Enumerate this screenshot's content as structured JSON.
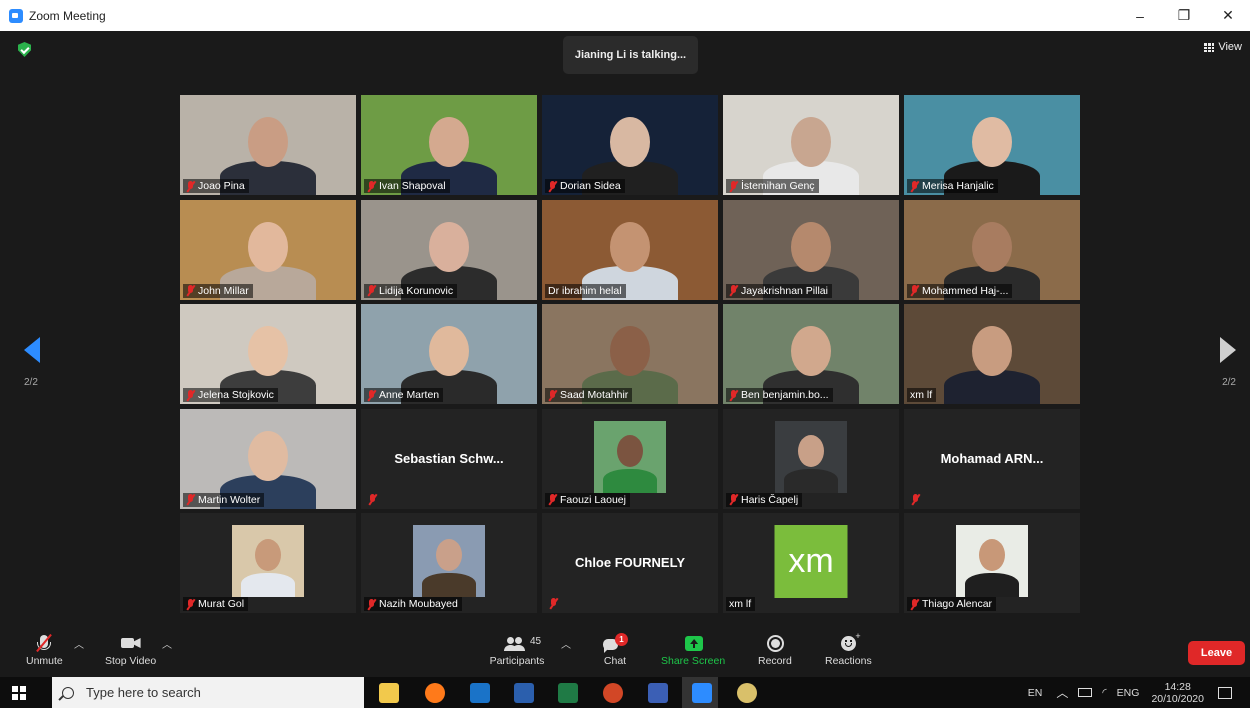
{
  "window": {
    "title": "Zoom Meeting",
    "controls": [
      "–",
      "❐",
      "✕"
    ]
  },
  "meeting": {
    "talking_indicator": "Jianing Li is talking...",
    "view_label": "View",
    "page_left": "2/2",
    "page_right": "2/2"
  },
  "participants": [
    {
      "name": "Joao Pina",
      "type": "video",
      "bg": "#b9b2a8",
      "head": "#c99d84",
      "body": "#2b2f3a"
    },
    {
      "name": "Ivan Shapoval",
      "type": "video",
      "bg": "#6e9c45",
      "head": "#d4a98f",
      "body": "#1f2a44"
    },
    {
      "name": "Dorian Sidea",
      "type": "video",
      "bg": "#152238",
      "head": "#d8b8a2",
      "body": "#202020"
    },
    {
      "name": "İstemihan Genç",
      "type": "video",
      "bg": "#d7d4cd",
      "head": "#c8a690",
      "body": "#e8e8e8"
    },
    {
      "name": "Merisa Hanjalic",
      "type": "video",
      "bg": "#4a8fa3",
      "head": "#e0bba3",
      "body": "#1a1a1a"
    },
    {
      "name": "John Millar",
      "type": "video",
      "bg": "#b88d52",
      "head": "#e2b89c",
      "body": "#b8a89a"
    },
    {
      "name": "Lidija Korunovic",
      "type": "video",
      "bg": "#9a948c",
      "head": "#d9b09c",
      "body": "#2c2c2c"
    },
    {
      "name": "Dr ibrahim helal",
      "type": "video",
      "bg": "#8c5a34",
      "head": "#c49372",
      "body": "#cfd6de"
    },
    {
      "name": "Jayakrishnan Pillai",
      "type": "video",
      "bg": "#6f6257",
      "head": "#b5896d",
      "body": "#3a3a3a"
    },
    {
      "name": "Mohammed Haj-...",
      "type": "video",
      "bg": "#8b6b4a",
      "head": "#a87c60",
      "body": "#2b2b2b"
    },
    {
      "name": "Jelena Stojkovic",
      "type": "video",
      "bg": "#cfc9c0",
      "head": "#e6c2a6",
      "body": "#3d3d3d"
    },
    {
      "name": "Anne Marten",
      "type": "video",
      "bg": "#8fa2ac",
      "head": "#e0b99c",
      "body": "#2a2a2a"
    },
    {
      "name": "Saad Motahhir",
      "type": "video",
      "bg": "#8a7560",
      "head": "#8b6048",
      "body": "#5b6b4a"
    },
    {
      "name": "Ben benjamin.bo...",
      "type": "video",
      "bg": "#71836a",
      "head": "#d1a88d",
      "body": "#2f2f2f"
    },
    {
      "name": "xm lf",
      "type": "video",
      "bg": "#5d4a38",
      "head": "#c89c80",
      "body": "#1e2230"
    },
    {
      "name": "Martin Wolter",
      "type": "video",
      "bg": "#bcbab8",
      "head": "#e0bba1",
      "body": "#2c3f5c"
    },
    {
      "name": "Sebastian  Schw...",
      "type": "name"
    },
    {
      "name": "Faouzi Laouej",
      "type": "photo",
      "bg": "#6aa36e",
      "head": "#7b5440",
      "body": "#2e8a3f"
    },
    {
      "name": "Haris Čapelj",
      "type": "photo",
      "bg": "#3a3d40",
      "head": "#c8a088",
      "body": "#2a2a2a"
    },
    {
      "name": "Mohamad  ARN...",
      "type": "name"
    },
    {
      "name": "Murat Gol",
      "type": "photo",
      "bg": "#d9c8aa",
      "head": "#c89a7a",
      "body": "#e4e8ee"
    },
    {
      "name": "Nazih Moubayed",
      "type": "photo",
      "bg": "#8a9bb2",
      "head": "#c9a08a",
      "body": "#4a3a2a"
    },
    {
      "name": "Chloe FOURNELY",
      "type": "name"
    },
    {
      "name": "xm lf",
      "type": "logo",
      "logo_text": "xm"
    },
    {
      "name": "Thiago Alencar",
      "type": "photo",
      "bg": "#e9ece6",
      "head": "#c89878",
      "body": "#1f1f1f"
    }
  ],
  "toolbar": {
    "unmute": "Unmute",
    "stop_video": "Stop Video",
    "participants_label": "Participants",
    "participants_count": "45",
    "chat": "Chat",
    "chat_badge": "1",
    "share_screen": "Share Screen",
    "record": "Record",
    "reactions": "Reactions",
    "leave": "Leave",
    "share_color": "#1ec64a",
    "leave_color": "#e02828"
  },
  "taskbar": {
    "search_placeholder": "Type here to search",
    "lang": "EN",
    "ime": "ENG",
    "time": "14:28",
    "date": "20/10/2020",
    "apps": [
      "file-explorer-icon",
      "firefox-icon",
      "outlook-icon",
      "word-icon",
      "excel-icon",
      "powerpoint-icon",
      "visio-icon",
      "zoom-icon",
      "paint-icon"
    ]
  }
}
